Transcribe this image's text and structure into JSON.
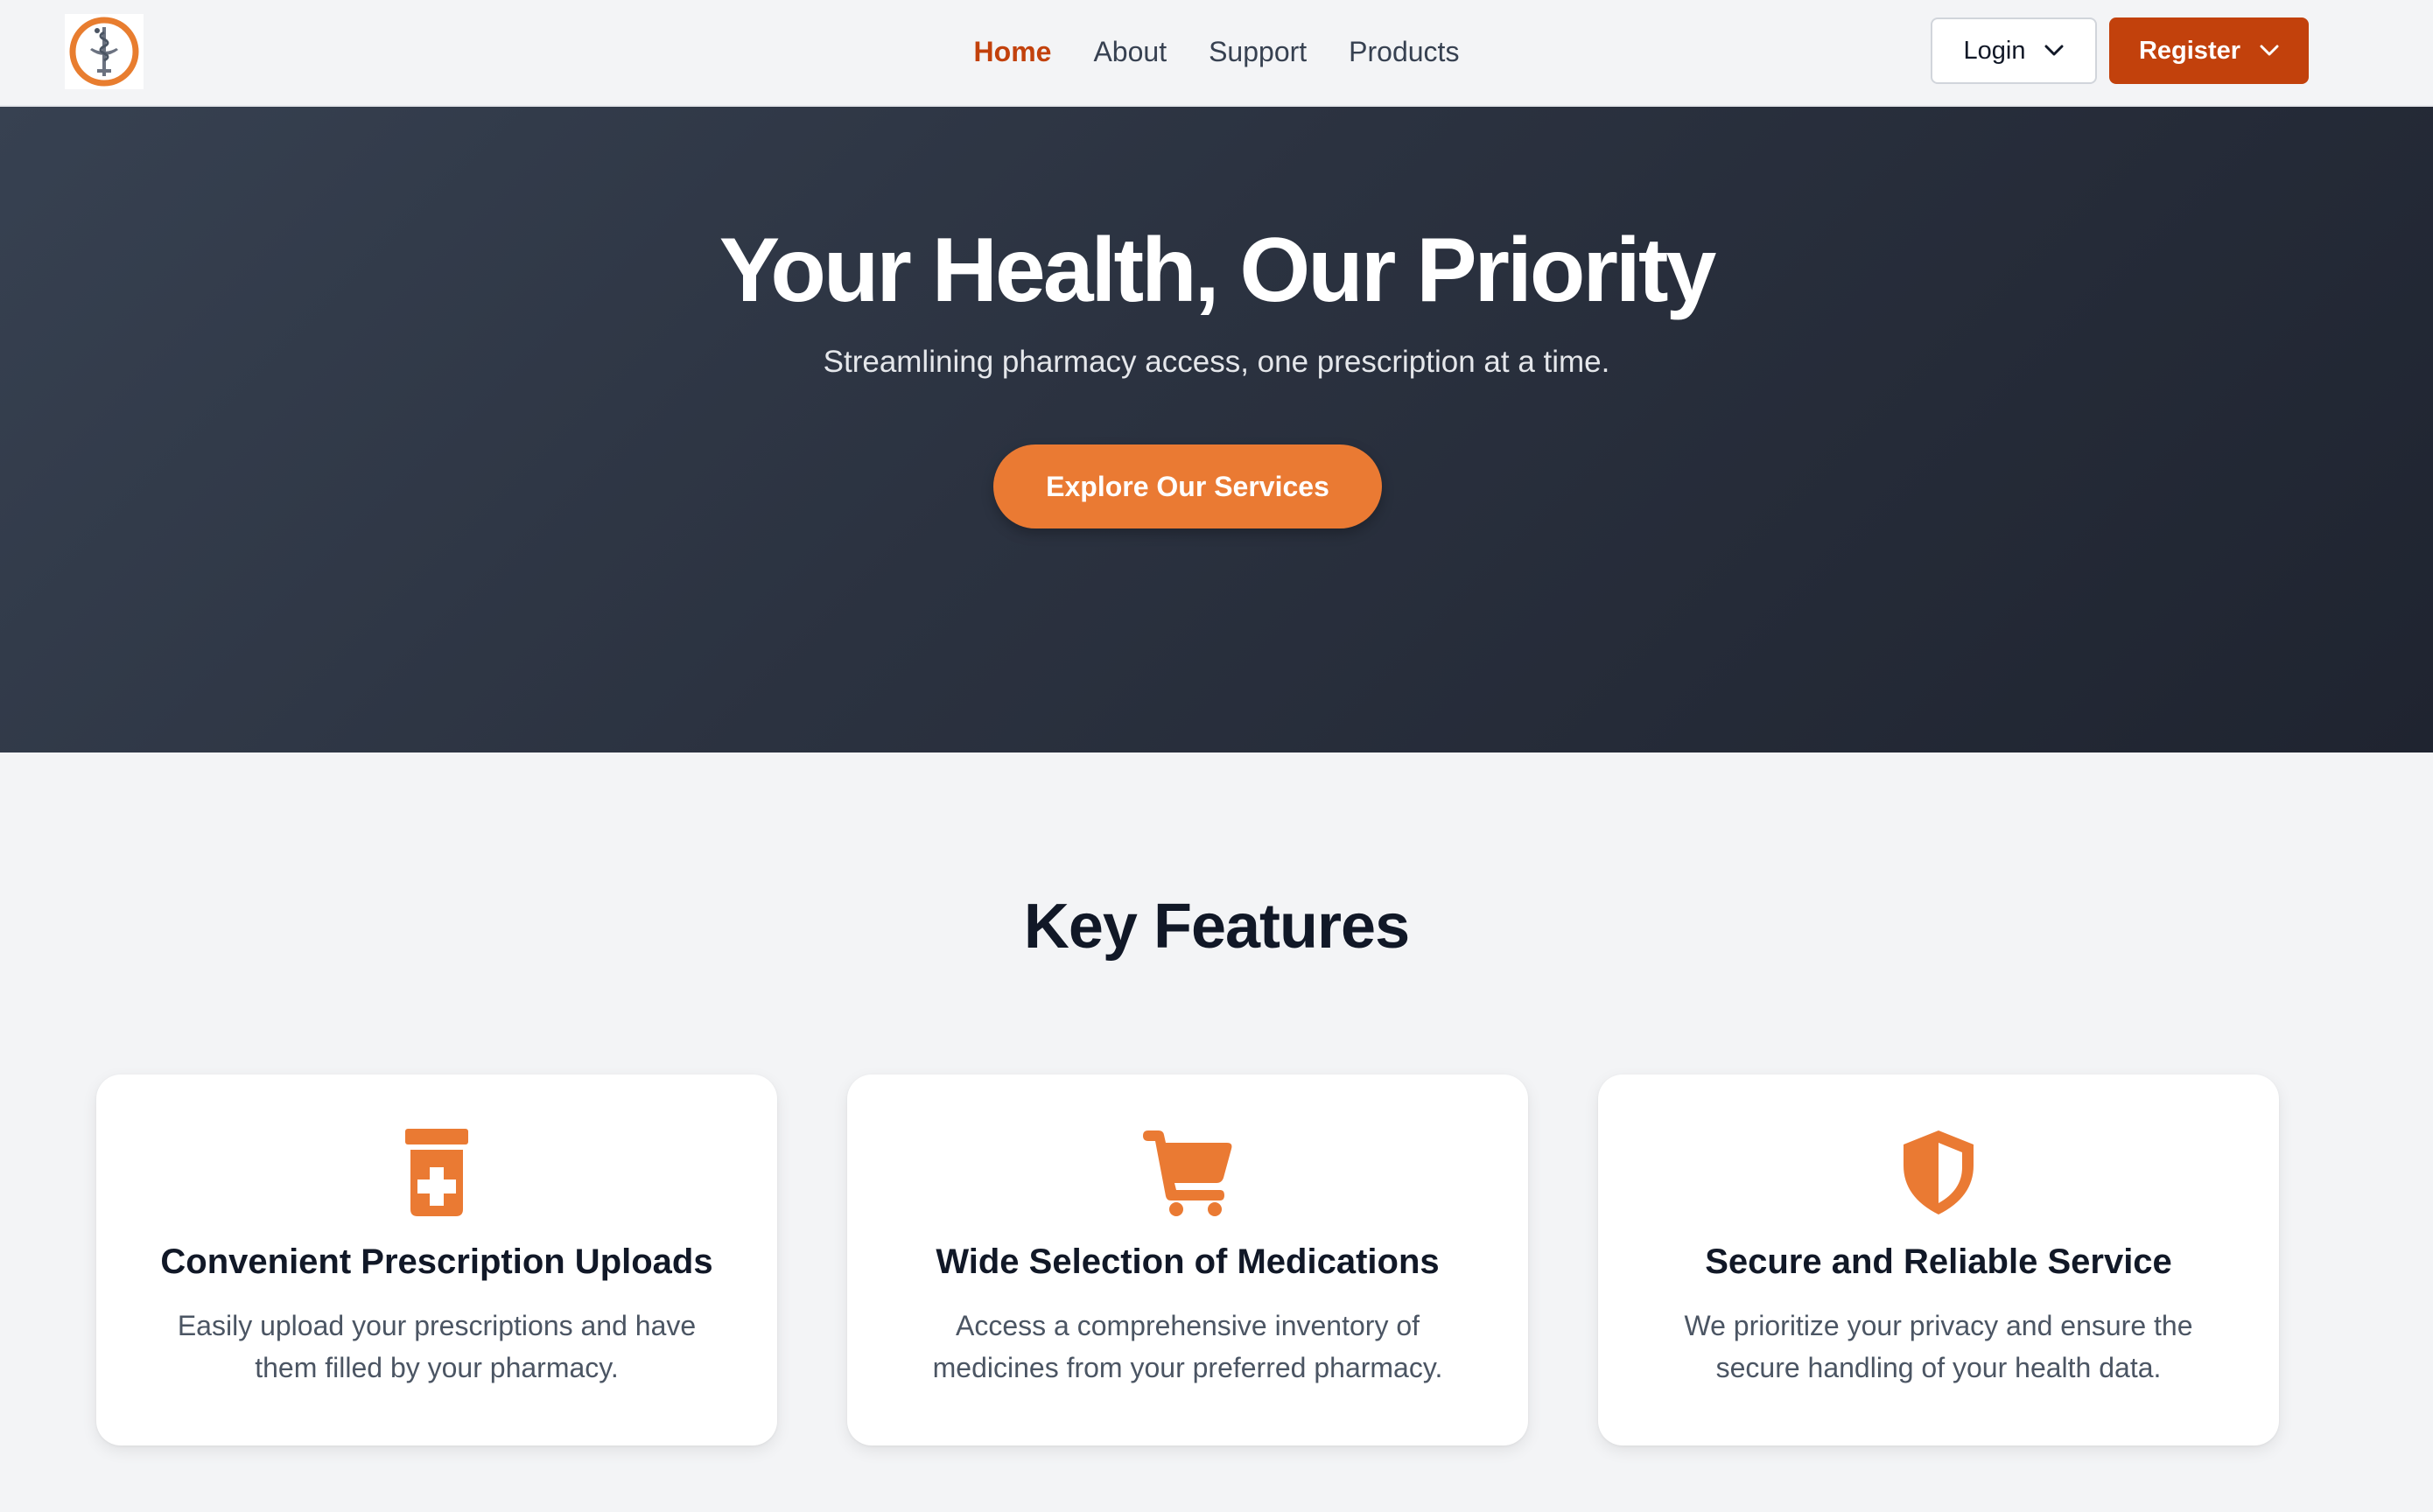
{
  "nav": {
    "links": [
      {
        "label": "Home",
        "active": true
      },
      {
        "label": "About",
        "active": false
      },
      {
        "label": "Support",
        "active": false
      },
      {
        "label": "Products",
        "active": false
      }
    ],
    "login_label": "Login",
    "register_label": "Register"
  },
  "hero": {
    "title": "Your Health, Our Priority",
    "subtitle": "Streamlining pharmacy access, one prescription at a time.",
    "cta_label": "Explore Our Services"
  },
  "features": {
    "title": "Key Features",
    "cards": [
      {
        "icon": "prescription-bottle-icon",
        "title": "Convenient Prescription Uploads",
        "description": "Easily upload your prescriptions and have them filled by your pharmacy."
      },
      {
        "icon": "shopping-cart-icon",
        "title": "Wide Selection of Medications",
        "description": "Access a comprehensive inventory of medicines from your preferred pharmacy."
      },
      {
        "icon": "shield-icon",
        "title": "Secure and Reliable Service",
        "description": "We prioritize your privacy and ensure the secure handling of your health data."
      }
    ]
  },
  "colors": {
    "accent": "#ea7a33",
    "brand_dark": "#c2410c",
    "hero_bg": "#2b3240"
  }
}
